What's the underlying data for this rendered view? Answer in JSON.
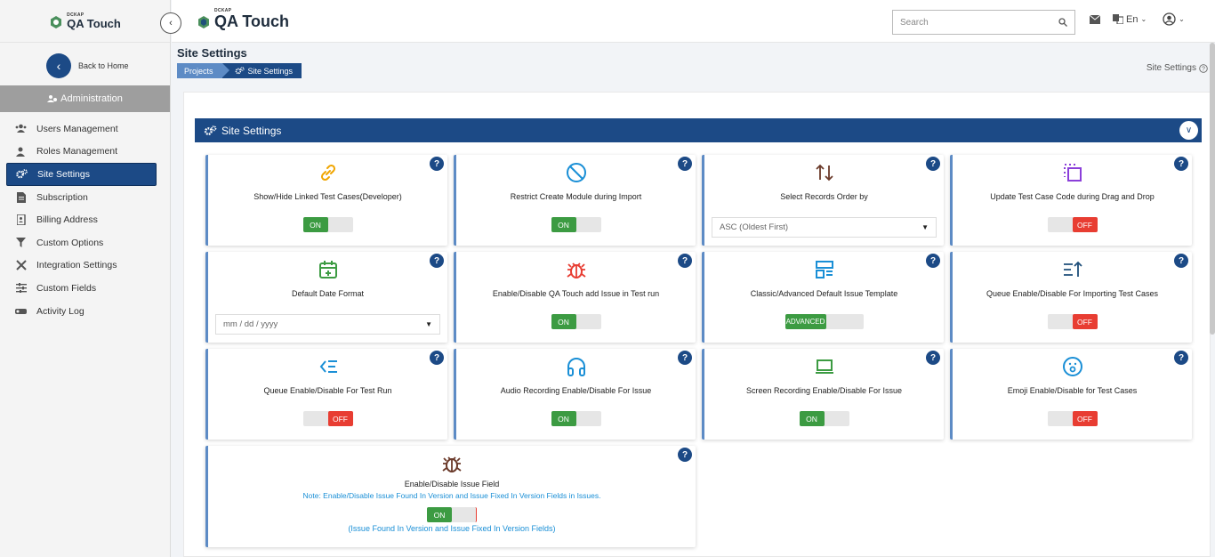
{
  "app": {
    "logo_small": "DCKAP",
    "logo_name": "QA Touch"
  },
  "sidebar": {
    "back_label": "Back to Home",
    "section_label": "Administration",
    "items": [
      {
        "label": "Users Management",
        "icon": "users-icon",
        "active": false
      },
      {
        "label": "Roles Management",
        "icon": "user-roles-icon",
        "active": false
      },
      {
        "label": "Site Settings",
        "icon": "cogs-icon",
        "active": true
      },
      {
        "label": "Subscription",
        "icon": "document-icon",
        "active": false
      },
      {
        "label": "Billing Address",
        "icon": "address-book-icon",
        "active": false
      },
      {
        "label": "Custom Options",
        "icon": "filter-icon",
        "active": false
      },
      {
        "label": "Integration Settings",
        "icon": "tools-icon",
        "active": false
      },
      {
        "label": "Custom Fields",
        "icon": "sliders-icon",
        "active": false
      },
      {
        "label": "Activity Log",
        "icon": "activity-icon",
        "active": false
      }
    ]
  },
  "topbar": {
    "search_placeholder": "Search",
    "language": "En"
  },
  "page": {
    "title": "Site Settings",
    "breadcrumb": [
      "Projects",
      "Site Settings"
    ],
    "help_link": "Site Settings"
  },
  "panel": {
    "title": "Site Settings"
  },
  "cards": [
    {
      "label": "Show/Hide Linked Test Cases(Developer)",
      "icon": "link-icon",
      "control": "toggle",
      "state": "ON"
    },
    {
      "label": "Restrict Create Module during Import",
      "icon": "ban-icon",
      "control": "toggle",
      "state": "ON"
    },
    {
      "label": "Select Records Order by",
      "icon": "sort-arrows-icon",
      "control": "select",
      "value": "ASC (Oldest First)"
    },
    {
      "label": "Update Test Case Code during Drag and Drop",
      "icon": "drag-drop-icon",
      "control": "toggle",
      "state": "OFF"
    },
    {
      "label": "Default Date Format",
      "icon": "calendar-icon",
      "control": "select",
      "value": "mm / dd / yyyy"
    },
    {
      "label": "Enable/Disable QA Touch add Issue in Test run",
      "icon": "bug-icon",
      "control": "toggle",
      "state": "ON"
    },
    {
      "label": "Classic/Advanced Default Issue Template",
      "icon": "template-icon",
      "control": "toggle",
      "state": "ADVANCED"
    },
    {
      "label": "Queue Enable/Disable For Importing Test Cases",
      "icon": "queue-import-icon",
      "control": "toggle",
      "state": "OFF"
    },
    {
      "label": "Queue Enable/Disable For Test Run",
      "icon": "queue-list-icon",
      "control": "toggle",
      "state": "OFF"
    },
    {
      "label": "Audio Recording Enable/Disable For Issue",
      "icon": "headphones-icon",
      "control": "toggle",
      "state": "ON"
    },
    {
      "label": "Screen Recording Enable/Disable For Issue",
      "icon": "laptop-icon",
      "control": "toggle",
      "state": "ON"
    },
    {
      "label": "Emoji Enable/Disable for Test Cases",
      "icon": "emoji-icon",
      "control": "toggle",
      "state": "OFF"
    }
  ],
  "issue_field_card": {
    "label": "Enable/Disable Issue Field",
    "note": "Note: Enable/Disable Issue Found In Version and Issue Fixed In Version Fields in Issues.",
    "state": "ON",
    "sub_note": "(Issue Found In Version and Issue Fixed In Version Fields)"
  },
  "colors": {
    "primary": "#1c4a86",
    "breadcrumb_light": "#5d8bc5",
    "on": "#3c9b42",
    "off": "#e83d32",
    "note_blue": "#1a8fd6"
  }
}
